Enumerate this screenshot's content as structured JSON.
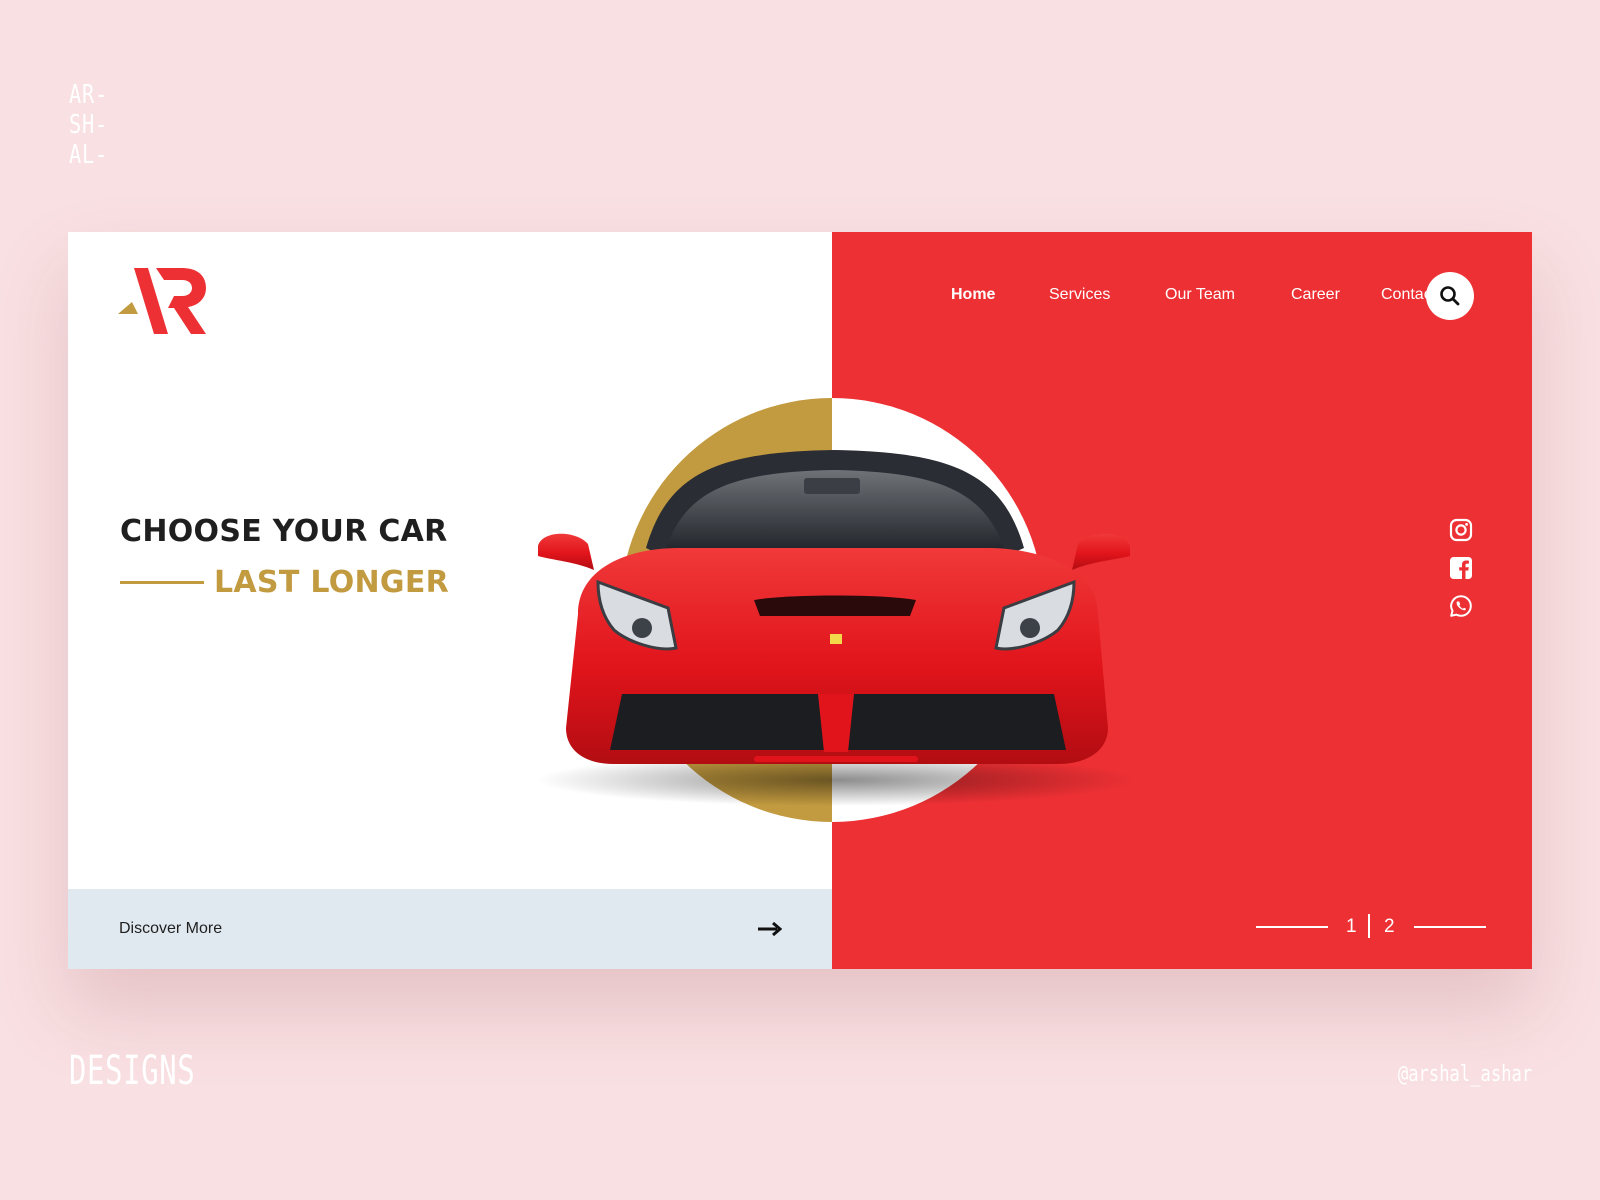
{
  "brand": {
    "stack": [
      "AR-",
      "SH-",
      "AL-"
    ],
    "footer_left": "DESIGNS",
    "footer_right": "@arshal_ashar"
  },
  "colors": {
    "background": "#f9e0e2",
    "accent_red": "#ed3034",
    "accent_gold": "#c29a3f",
    "discover_bar": "#e1e9f0",
    "text_dark": "#1f1f1f"
  },
  "logo": {
    "icon": "ar-logo-icon"
  },
  "hero": {
    "headline_1": "CHOOSE YOUR CAR",
    "headline_2": "LAST LONGER",
    "image": "red-sports-car"
  },
  "discover": {
    "label": "Discover More",
    "icon": "arrow-right-icon"
  },
  "nav": {
    "items": [
      {
        "label": "Home",
        "active": true
      },
      {
        "label": "Services",
        "active": false
      },
      {
        "label": "Our Team",
        "active": false
      },
      {
        "label": "Career",
        "active": false
      },
      {
        "label": "Contact Us",
        "active": false
      }
    ],
    "search_icon": "search-icon"
  },
  "social": [
    "instagram-icon",
    "facebook-icon",
    "whatsapp-icon"
  ],
  "pager": {
    "current": "1",
    "next": "2"
  }
}
